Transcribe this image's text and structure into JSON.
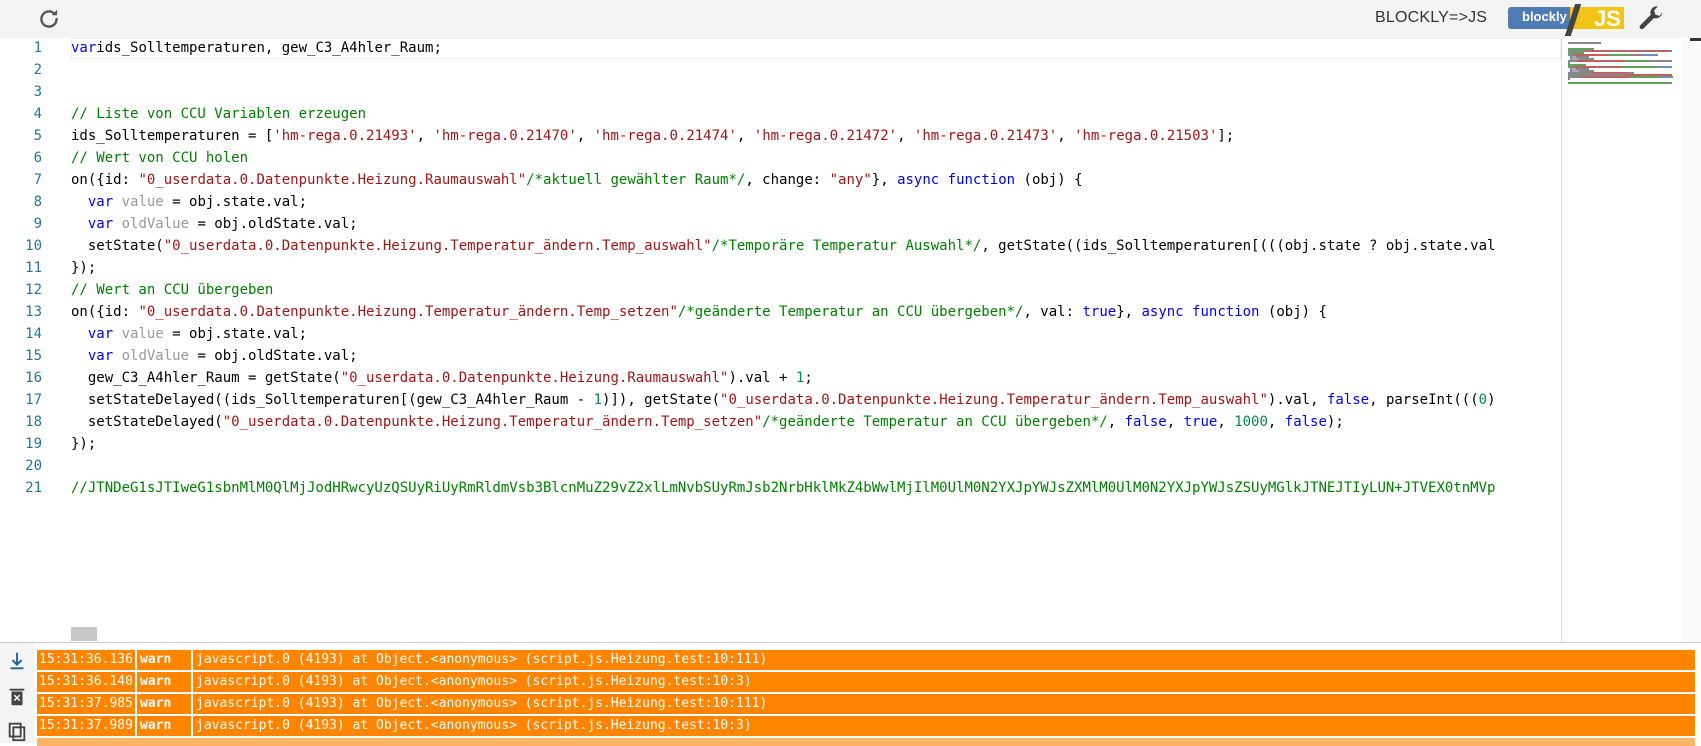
{
  "toolbar": {
    "refresh_icon": "refresh-icon",
    "mode_label": "BLOCKLY=>JS",
    "badge_left": "blockly",
    "badge_right": "JS",
    "wrench_icon": "wrench-icon"
  },
  "editor": {
    "line_numbers": [
      "1",
      "2",
      "3",
      "4",
      "5",
      "6",
      "7",
      "8",
      "9",
      "10",
      "11",
      "12",
      "13",
      "14",
      "15",
      "16",
      "17",
      "18",
      "19",
      "20",
      "21"
    ],
    "lines": [
      [
        [
          "kw",
          "var"
        ],
        [
          "",
          "ids_Solltemperaturen, gew_C3_A4hler_Raum;"
        ]
      ],
      [],
      [],
      [
        [
          "cm",
          "// Liste von CCU Variablen erzeugen"
        ]
      ],
      [
        [
          "",
          "ids_Solltemperaturen = ["
        ],
        [
          "str",
          "'hm-rega.0.21493'"
        ],
        [
          "",
          ", "
        ],
        [
          "str",
          "'hm-rega.0.21470'"
        ],
        [
          "",
          ", "
        ],
        [
          "str",
          "'hm-rega.0.21474'"
        ],
        [
          "",
          ", "
        ],
        [
          "str",
          "'hm-rega.0.21472'"
        ],
        [
          "",
          ", "
        ],
        [
          "str",
          "'hm-rega.0.21473'"
        ],
        [
          "",
          ", "
        ],
        [
          "str",
          "'hm-rega.0.21503'"
        ],
        [
          "",
          "];"
        ]
      ],
      [
        [
          "cm",
          "// Wert von CCU holen"
        ]
      ],
      [
        [
          "",
          "on({id: "
        ],
        [
          "str",
          "\"0_userdata.0.Datenpunkte.Heizung.Raumauswahl\""
        ],
        [
          "cm",
          "/*aktuell gewählter Raum*/"
        ],
        [
          "",
          ", change: "
        ],
        [
          "str",
          "\"any\""
        ],
        [
          "",
          "}, "
        ],
        [
          "kw",
          "async function"
        ],
        [
          "",
          " (obj) {"
        ]
      ],
      [
        [
          "",
          "  "
        ],
        [
          "kw",
          "var"
        ],
        [
          "dim",
          " value"
        ],
        [
          "",
          " = obj.state.val;"
        ]
      ],
      [
        [
          "",
          "  "
        ],
        [
          "kw",
          "var"
        ],
        [
          "dim",
          " oldValue"
        ],
        [
          "",
          " = obj.oldState.val;"
        ]
      ],
      [
        [
          "",
          "  setState("
        ],
        [
          "str",
          "\"0_userdata.0.Datenpunkte.Heizung.Temperatur_ändern.Temp_auswahl\""
        ],
        [
          "cm",
          "/*Temporäre Temperatur Auswahl*/"
        ],
        [
          "",
          ", getState((ids_Solltemperaturen[(((obj.state ? obj.state.val"
        ]
      ],
      [
        [
          "",
          "});"
        ]
      ],
      [
        [
          "cm",
          "// Wert an CCU übergeben"
        ]
      ],
      [
        [
          "",
          "on({id: "
        ],
        [
          "str",
          "\"0_userdata.0.Datenpunkte.Heizung.Temperatur_ändern.Temp_setzen\""
        ],
        [
          "cm",
          "/*geänderte Temperatur an CCU übergeben*/"
        ],
        [
          "",
          ", val: "
        ],
        [
          "kw",
          "true"
        ],
        [
          "",
          "}, "
        ],
        [
          "kw",
          "async function"
        ],
        [
          "",
          " (obj) {"
        ]
      ],
      [
        [
          "",
          "  "
        ],
        [
          "kw",
          "var"
        ],
        [
          "dim",
          " value"
        ],
        [
          "",
          " = obj.state.val;"
        ]
      ],
      [
        [
          "",
          "  "
        ],
        [
          "kw",
          "var"
        ],
        [
          "dim",
          " oldValue"
        ],
        [
          "",
          " = obj.oldState.val;"
        ]
      ],
      [
        [
          "",
          "  gew_C3_A4hler_Raum = getState("
        ],
        [
          "str",
          "\"0_userdata.0.Datenpunkte.Heizung.Raumauswahl\""
        ],
        [
          "",
          ").val + "
        ],
        [
          "num",
          "1"
        ],
        [
          "",
          ";"
        ]
      ],
      [
        [
          "",
          "  setStateDelayed((ids_Solltemperaturen[(gew_C3_A4hler_Raum - "
        ],
        [
          "num",
          "1"
        ],
        [
          "",
          ")]), getState("
        ],
        [
          "str",
          "\"0_userdata.0.Datenpunkte.Heizung.Temperatur_ändern.Temp_auswahl\""
        ],
        [
          "",
          ").val, "
        ],
        [
          "kw",
          "false"
        ],
        [
          "",
          ", parseInt((("
        ],
        [
          "num",
          "0"
        ],
        [
          "",
          ")"
        ]
      ],
      [
        [
          "",
          "  setStateDelayed("
        ],
        [
          "str",
          "\"0_userdata.0.Datenpunkte.Heizung.Temperatur_ändern.Temp_setzen\""
        ],
        [
          "cm",
          "/*geänderte Temperatur an CCU übergeben*/"
        ],
        [
          "",
          ", "
        ],
        [
          "kw",
          "false"
        ],
        [
          "",
          ", "
        ],
        [
          "kw",
          "true"
        ],
        [
          "",
          ", "
        ],
        [
          "num",
          "1000"
        ],
        [
          "",
          ", "
        ],
        [
          "kw",
          "false"
        ],
        [
          "",
          ");"
        ]
      ],
      [
        [
          "",
          "});"
        ]
      ],
      [],
      [
        [
          "cm",
          "//JTNDeG1sJTIweG1sbnMlM0QlMjJodHRwcyUzQSUyRiUyRmRldmVsb3BlcnMuZ29vZ2xlLmNvbSUyRmJsb2NrbHklMkZ4bWwlMjIlM0UlM0N2YXJpYWJsZXMlM0UlM0N2YXJpYWJsZSUyMGlkJTNEJTIyLUN+JTVEX0tnMVp"
        ]
      ]
    ]
  },
  "log": {
    "side_icons": [
      "scroll-down-icon",
      "delete-icon",
      "copy-icon"
    ],
    "rows": [
      {
        "time": "15:31:36.136",
        "level": "warn",
        "message": "javascript.0 (4193) at Object.<anonymous> (script.js.Heizung.test:10:111)"
      },
      {
        "time": "15:31:36.140",
        "level": "warn",
        "message": "javascript.0 (4193) at Object.<anonymous> (script.js.Heizung.test:10:3)"
      },
      {
        "time": "15:31:37.985",
        "level": "warn",
        "message": "javascript.0 (4193) at Object.<anonymous> (script.js.Heizung.test:10:111)"
      },
      {
        "time": "15:31:37.989",
        "level": "warn",
        "message": "javascript.0 (4193) at Object.<anonymous> (script.js.Heizung.test:10:3)"
      }
    ],
    "colors": {
      "warn_bg": "#ff8400"
    }
  }
}
